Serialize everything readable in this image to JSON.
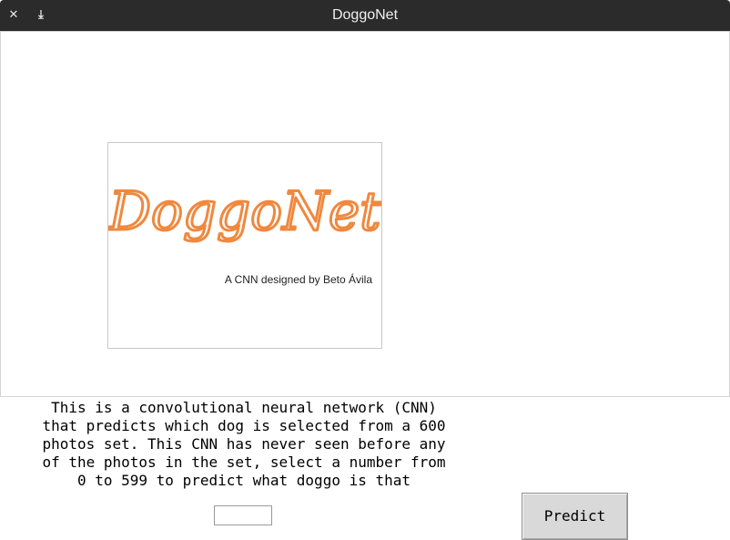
{
  "window": {
    "title": "DoggoNet",
    "close_glyph": "✕",
    "minimize_glyph": "⤓",
    "close_icon": "close-icon",
    "minimize_icon": "minimize-icon"
  },
  "logo": {
    "title": "DoggoNet",
    "subtitle": "A CNN designed by Beto Ávila",
    "accent_color": "#f0883e"
  },
  "description": "This is a convolutional neural network (CNN)\nthat predicts which dog is selected from a 600\nphotos set. This CNN has never seen before any\nof the photos in the set, select a number from\n0 to 599 to predict what doggo is that",
  "number_input": {
    "value": "",
    "placeholder": ""
  },
  "predict_button": {
    "label": "Predict"
  }
}
